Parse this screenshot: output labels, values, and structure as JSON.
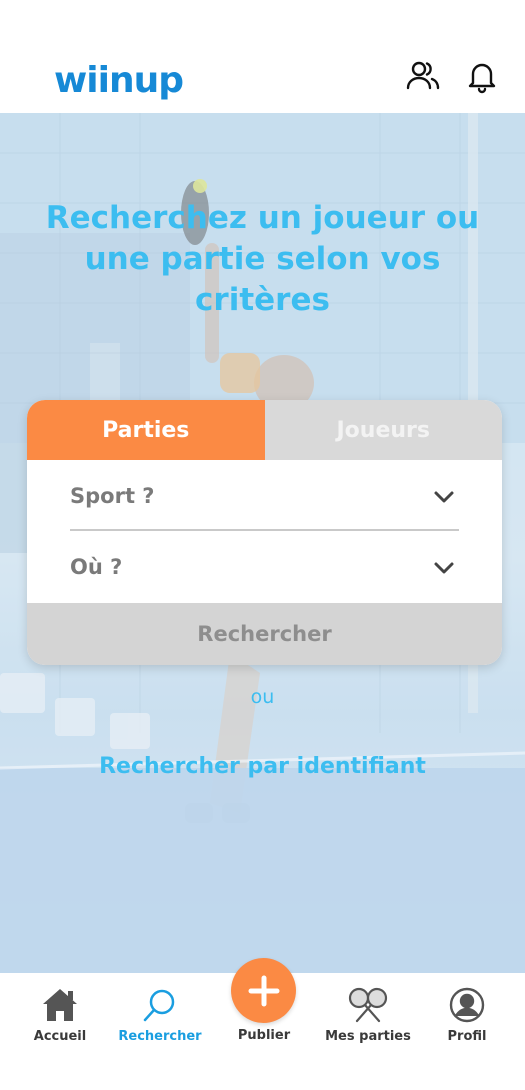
{
  "header": {
    "logo": "wiinup",
    "icons": [
      "users-icon",
      "bell-icon"
    ]
  },
  "hero": {
    "headline": "Recherchez un joueur ou une partie selon vos critères"
  },
  "search": {
    "tabs": [
      {
        "label": "Parties",
        "active": true
      },
      {
        "label": "Joueurs",
        "active": false
      }
    ],
    "sport_label": "Sport ?",
    "where_label": "Où ?",
    "button_label": "Rechercher"
  },
  "alt": {
    "or_label": "ou",
    "by_id_label": "Rechercher par identifiant"
  },
  "nav": {
    "items": [
      {
        "label": "Accueil",
        "icon": "home-icon"
      },
      {
        "label": "Rechercher",
        "icon": "search-icon"
      },
      {
        "label": "Publier",
        "icon": "plus-icon"
      },
      {
        "label": "Mes parties",
        "icon": "rackets-icon"
      },
      {
        "label": "Profil",
        "icon": "profile-icon"
      }
    ],
    "active": "Rechercher"
  },
  "colors": {
    "brand_blue": "#1689d6",
    "headline_blue": "#3cbdf0",
    "accent_orange": "#fb8a44",
    "inactive_gray": "#d9d9d9"
  }
}
